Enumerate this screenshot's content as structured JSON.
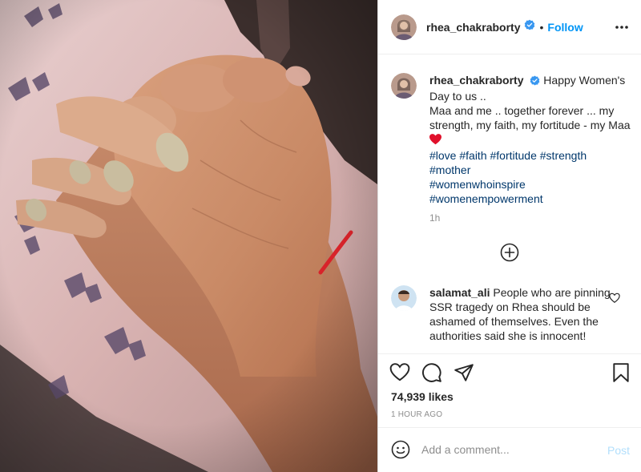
{
  "post": {
    "username": "rhea_chakraborty",
    "verified": true,
    "follow_label": "Follow",
    "header_separator": "•",
    "caption_line1": "Happy Women's Day to us ..",
    "caption_line2": "Maa and me .. together forever ... my strength, my faith, my fortitude - my Maa",
    "caption_emoji": "red-heart-icon",
    "hashtags": [
      "#love",
      "#faith",
      "#fortitude",
      "#strength",
      "#mother",
      "#womenwhoinspire",
      "#womenempowerment"
    ],
    "caption_time": "1h"
  },
  "comment": {
    "username": "salamat_ali",
    "text": "People who are pinning SSR tragedy on Rhea should be ashamed of themselves. Even the authorities said she is innocent!"
  },
  "stats": {
    "likes": "74,939 likes",
    "posted": "1 HOUR AGO"
  },
  "composer": {
    "placeholder": "Add a comment...",
    "post_label": "Post"
  },
  "icons": {
    "more": "more-options-icon",
    "like": "heart-outline-icon",
    "comment": "speech-bubble-icon",
    "share": "paper-plane-icon",
    "save": "bookmark-icon",
    "emoji": "smiley-icon",
    "load_more": "plus-circle-icon"
  },
  "colors": {
    "link_blue": "#0095f6",
    "hashtag_blue": "#00376b",
    "muted_gray": "#8e8e8e",
    "post_disabled": "#b2dffc",
    "heart_red": "#e0102b"
  }
}
